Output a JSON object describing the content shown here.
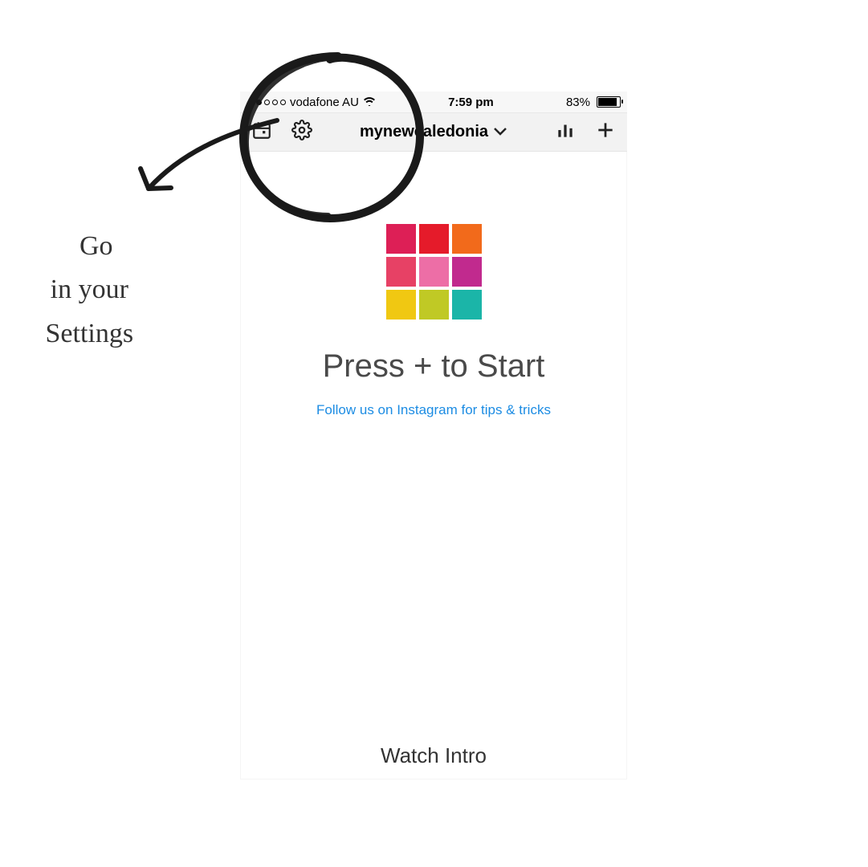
{
  "statusbar": {
    "carrier": "vodafone AU",
    "time": "7:59 pm",
    "battery_pct": "83%"
  },
  "navbar": {
    "account": "mynewcaledonia",
    "icons": [
      "calendar",
      "settings",
      "stats",
      "plus"
    ]
  },
  "main": {
    "heading": "Press + to Start",
    "link": "Follow us on Instagram for tips & tricks",
    "watch_intro": "Watch Intro"
  },
  "annotation": {
    "text": "   Go\n in your\n Settings"
  },
  "logo_colors": [
    "#dd1f56",
    "#e51b2a",
    "#f26a1b",
    "#e74165",
    "#ed6ea6",
    "#c12a8e",
    "#f0c812",
    "#c0c925",
    "#1bb5a8"
  ]
}
